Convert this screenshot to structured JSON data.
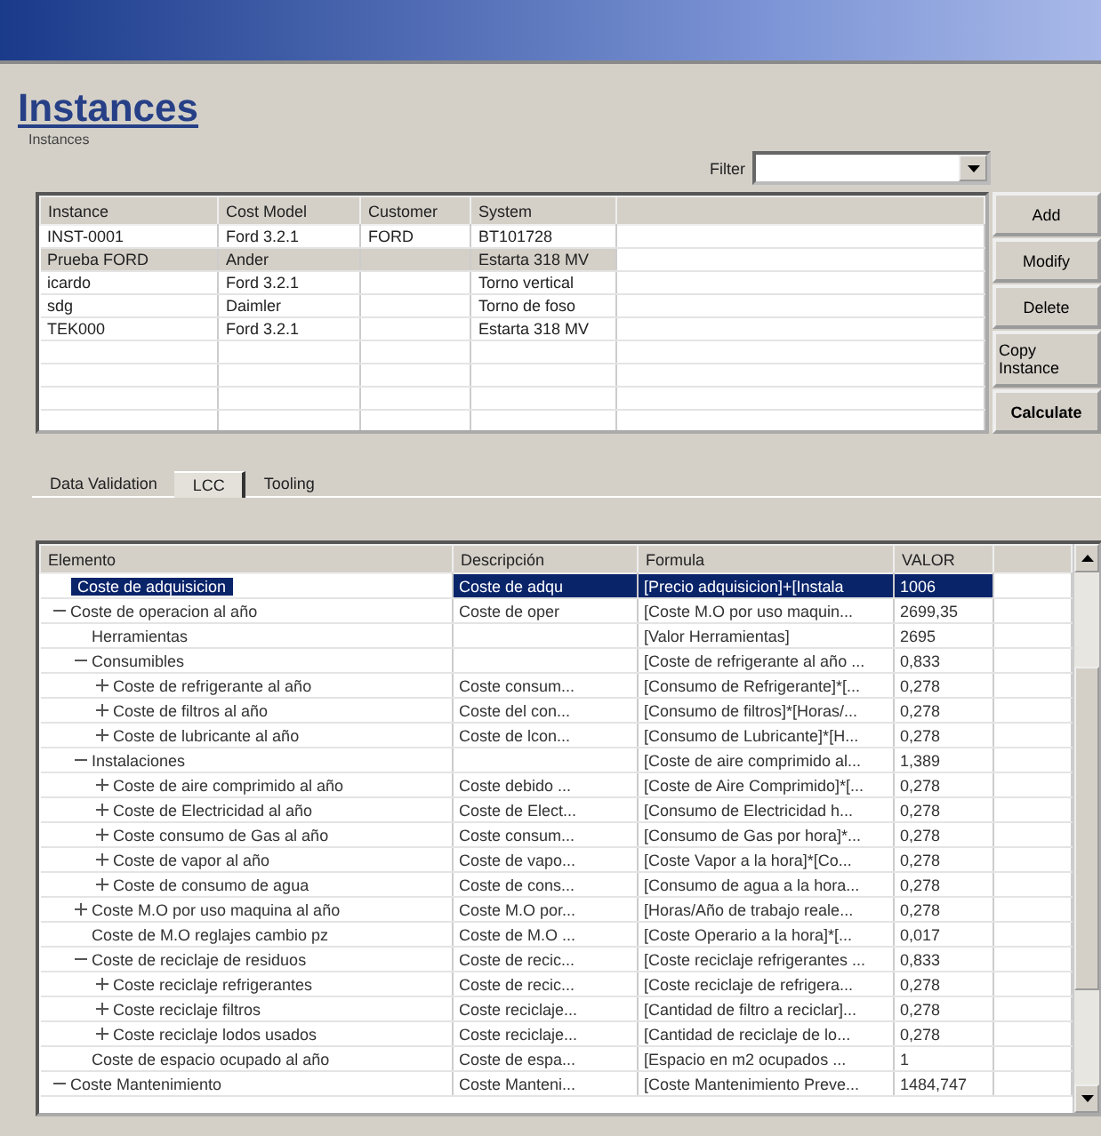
{
  "page": {
    "heading": "Instances",
    "group_label": "Instances"
  },
  "filter": {
    "label": "Filter"
  },
  "instances_table": {
    "columns": [
      "Instance",
      "Cost Model",
      "Customer",
      "System"
    ],
    "rows": [
      {
        "cells": [
          "INST-0001",
          "Ford 3.2.1",
          "FORD",
          "BT101728"
        ],
        "selected": false
      },
      {
        "cells": [
          "Prueba FORD",
          "Ander",
          "",
          "Estarta 318 MV"
        ],
        "selected": true
      },
      {
        "cells": [
          "icardo",
          "Ford 3.2.1",
          "",
          "Torno vertical"
        ],
        "selected": false
      },
      {
        "cells": [
          "sdg",
          "Daimler",
          "",
          "Torno de foso"
        ],
        "selected": false
      },
      {
        "cells": [
          "TEK000",
          "Ford 3.2.1",
          "",
          "Estarta 318 MV"
        ],
        "selected": false
      }
    ]
  },
  "buttons": [
    {
      "label": "Add",
      "bold": false
    },
    {
      "label": "Modify",
      "bold": false
    },
    {
      "label": "Delete",
      "bold": false
    },
    {
      "label": "Copy Instance",
      "bold": false
    },
    {
      "label": "Calculate",
      "bold": true
    }
  ],
  "tabs": [
    {
      "label": "Data Validation",
      "selected": false
    },
    {
      "label": "LCC",
      "selected": true
    },
    {
      "label": "Tooling",
      "selected": false
    }
  ],
  "lcc_grid": {
    "columns": [
      "Elemento",
      "Descripción",
      "Formula",
      "VALOR"
    ],
    "rows": [
      {
        "label": "Coste de adquisicion",
        "description": "Coste de adqu",
        "formula": "[Precio adquisicion]+[Instala",
        "value": "1006",
        "selected": true
      },
      {
        "label": "Coste de operacion al año",
        "description": "Coste de oper",
        "formula": "[Coste M.O por uso maquin...",
        "value": "2699,35",
        "selected": false,
        "expanded": true,
        "children": [
          {
            "label": "Herramientas",
            "formula": "[Valor Herramientas]",
            "value": "2695",
            "selected": false
          },
          {
            "label": "Consumibles",
            "formula": "[Coste de refrigerante al año ...",
            "value": "0,833",
            "selected": false,
            "expanded": true,
            "children": [
              {
                "label": "Coste de refrigerante al año",
                "description": "Coste consum...",
                "formula": "[Consumo de Refrigerante]*[...",
                "value": "0,278",
                "selected": false,
                "expanded": false
              },
              {
                "label": "Coste de filtros al año",
                "description": "Coste del con...",
                "formula": "[Consumo de filtros]*[Horas/...",
                "value": "0,278",
                "selected": false,
                "expanded": false
              },
              {
                "label": "Coste de lubricante al año",
                "description": "Coste de lcon...",
                "formula": "[Consumo de Lubricante]*[H...",
                "value": "0,278",
                "selected": false,
                "expanded": false
              }
            ]
          },
          {
            "label": "Instalaciones",
            "formula": "[Coste de aire comprimido al...",
            "value": "1,389",
            "selected": false,
            "expanded": true,
            "children": [
              {
                "label": "Coste de aire comprimido al año",
                "description": "Coste debido ...",
                "formula": "[Coste de Aire Comprimido]*[...",
                "value": "0,278",
                "selected": false,
                "expanded": false
              },
              {
                "label": "Coste de Electricidad al año",
                "description": "Coste de Elect...",
                "formula": "[Consumo de Electricidad h...",
                "value": "0,278",
                "selected": false,
                "expanded": false
              },
              {
                "label": "Coste consumo de Gas al año",
                "description": "Coste consum...",
                "formula": "[Consumo de Gas por hora]*...",
                "value": "0,278",
                "selected": false,
                "expanded": false
              },
              {
                "label": "Coste de vapor al año",
                "description": "Coste de vapo...",
                "formula": "[Coste Vapor a la hora]*[Co...",
                "value": "0,278",
                "selected": false,
                "expanded": false
              },
              {
                "label": "Coste de consumo de agua",
                "description": "Coste de cons...",
                "formula": "[Consumo de agua a la hora...",
                "value": "0,278",
                "selected": false,
                "expanded": false
              }
            ]
          },
          {
            "label": "Coste M.O por uso maquina al año",
            "description": "Coste M.O por...",
            "formula": "[Horas/Año de trabajo reale...",
            "value": "0,278",
            "selected": false,
            "expanded": false
          },
          {
            "label": "Coste de M.O reglajes cambio pz",
            "description": "Coste de M.O ...",
            "formula": "[Coste Operario a la hora]*[...",
            "value": "0,017",
            "selected": false
          },
          {
            "label": "Coste de reciclaje de residuos",
            "description": "Coste de recic...",
            "formula": "[Coste reciclaje refrigerantes ...",
            "value": "0,833",
            "selected": false,
            "expanded": true,
            "children": [
              {
                "label": "Coste reciclaje refrigerantes",
                "description": "Coste de recic...",
                "formula": "[Coste reciclaje de refrigera...",
                "value": "0,278",
                "selected": false,
                "expanded": false
              },
              {
                "label": "Coste reciclaje filtros",
                "description": "Coste reciclaje...",
                "formula": "[Cantidad de filtro a reciclar]...",
                "value": "0,278",
                "selected": false,
                "expanded": false
              },
              {
                "label": "Coste reciclaje lodos usados",
                "description": "Coste reciclaje...",
                "formula": "[Cantidad de reciclaje de lo...",
                "value": "0,278",
                "selected": false,
                "expanded": false
              }
            ]
          },
          {
            "label": "Coste de espacio ocupado al año",
            "description": "Coste de espa...",
            "formula": "[Espacio en m2 ocupados ...",
            "value": "1",
            "selected": false
          }
        ]
      },
      {
        "label": "Coste Mantenimiento",
        "description": "Coste Manteni...",
        "formula": "[Coste Mantenimiento Preve...",
        "value": "1484,747",
        "selected": false,
        "expanded": true
      }
    ]
  }
}
